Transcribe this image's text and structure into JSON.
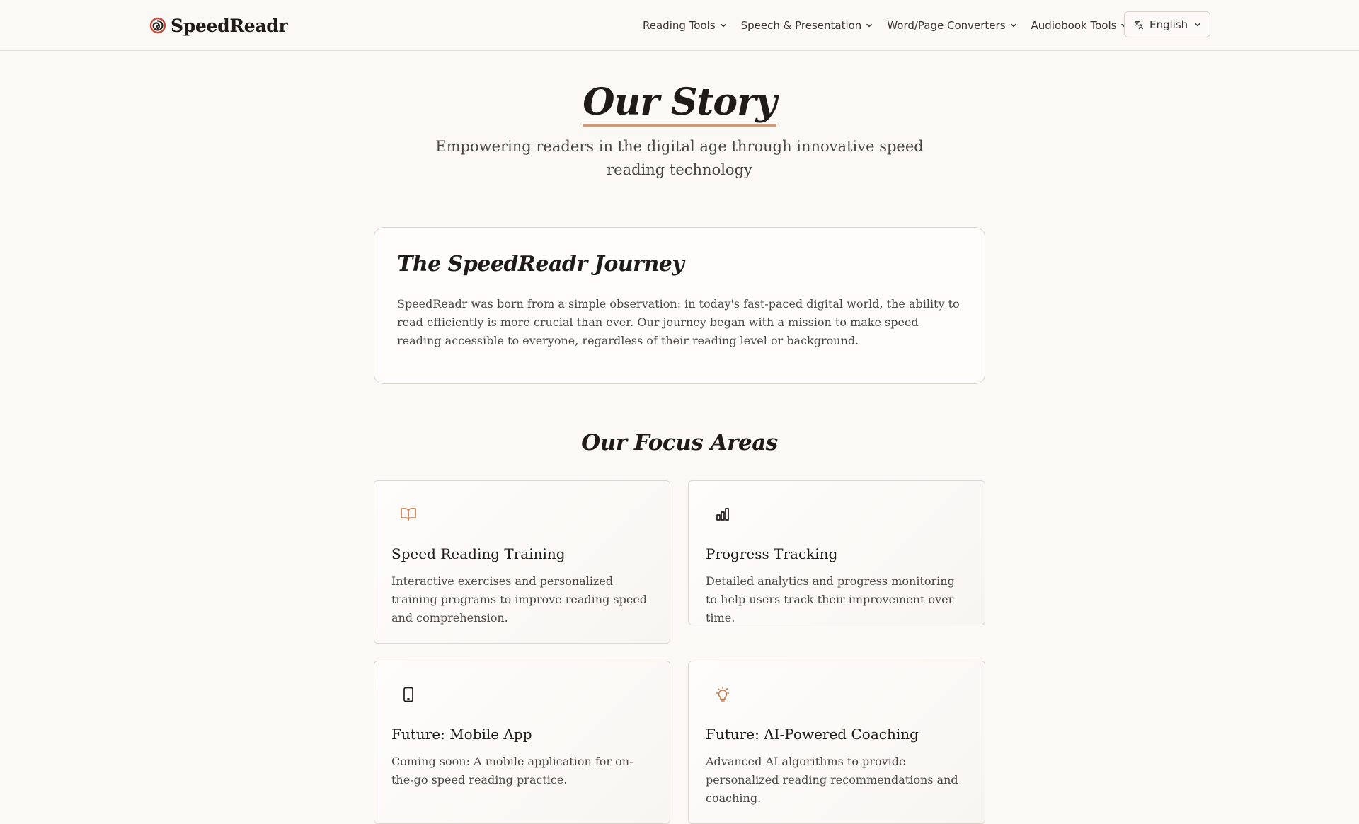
{
  "header": {
    "brand": "SpeedReadr",
    "nav": [
      {
        "label": "Reading Tools"
      },
      {
        "label": "Speech & Presentation"
      },
      {
        "label": "Word/Page Converters"
      },
      {
        "label": "Audiobook Tools"
      }
    ],
    "language": "English"
  },
  "hero": {
    "title": "Our Story",
    "subtitle": "Empowering readers in the digital age through innovative speed reading technology"
  },
  "journey": {
    "title": "The SpeedReadr Journey",
    "text": "SpeedReadr was born from a simple observation: in today's fast-paced digital world, the ability to read efficiently is more crucial than ever. Our journey began with a mission to make speed reading accessible to everyone, regardless of their reading level or background."
  },
  "focus": {
    "title": "Our Focus Areas",
    "cards": [
      {
        "icon": "book-open-icon",
        "title": "Speed Reading Training",
        "text": "Interactive exercises and personalized training programs to improve reading speed and comprehension."
      },
      {
        "icon": "bar-chart-icon",
        "title": "Progress Tracking",
        "text": "Detailed analytics and progress monitoring to help users track their improvement over time."
      },
      {
        "icon": "smartphone-icon",
        "title": "Future: Mobile App",
        "text": "Coming soon: A mobile application for on-the-go speed reading practice."
      },
      {
        "icon": "lightbulb-icon",
        "title": "Future: AI-Powered Coaching",
        "text": "Advanced AI algorithms to provide personalized reading recommendations and coaching."
      }
    ]
  },
  "colors": {
    "accent": "#d19a7a",
    "icon_orange": "#c77a4c",
    "background": "#faf9f6",
    "text": "#1e1b18"
  }
}
